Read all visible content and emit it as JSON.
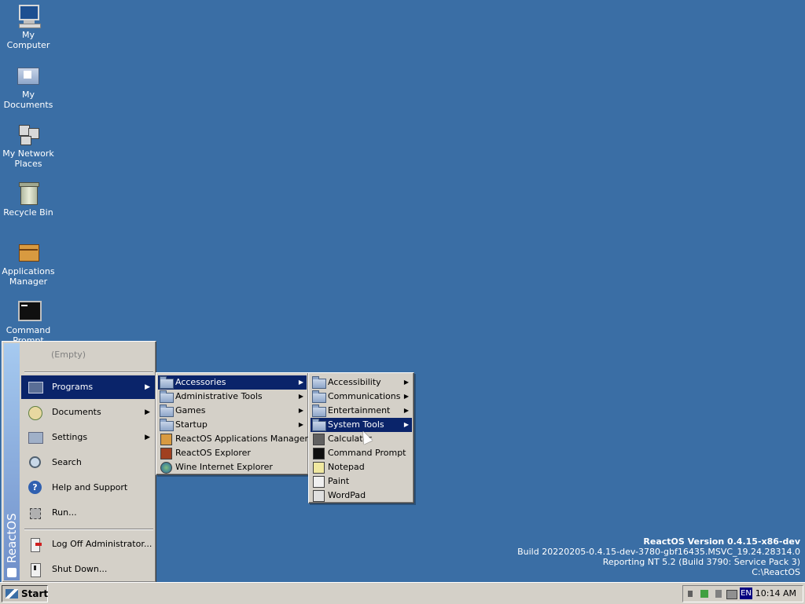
{
  "desktop": {
    "icons": [
      {
        "label": "My Computer",
        "icon": "my-computer-icon"
      },
      {
        "label": "My Documents",
        "icon": "my-documents-icon"
      },
      {
        "label": "My Network Places",
        "icon": "network-places-icon"
      },
      {
        "label": "Recycle Bin",
        "icon": "recycle-bin-icon"
      },
      {
        "label": "Applications Manager",
        "icon": "applications-manager-icon"
      },
      {
        "label": "Command Prompt",
        "icon": "command-prompt-icon"
      }
    ]
  },
  "start_menu": {
    "brand": "ReactOS",
    "recent_empty": "(Empty)",
    "items": [
      {
        "label": "Programs",
        "icon": "programs-icon",
        "has_submenu": true,
        "selected": true
      },
      {
        "label": "Documents",
        "icon": "documents-icon",
        "has_submenu": true
      },
      {
        "label": "Settings",
        "icon": "settings-icon",
        "has_submenu": true
      },
      {
        "label": "Search",
        "icon": "search-icon"
      },
      {
        "label": "Help and Support",
        "icon": "help-icon"
      },
      {
        "label": "Run...",
        "icon": "run-icon"
      },
      {
        "label": "Log Off Administrator...",
        "icon": "log-off-icon"
      },
      {
        "label": "Shut Down...",
        "icon": "shut-down-icon"
      }
    ]
  },
  "programs_menu": {
    "items": [
      {
        "label": "Accessories",
        "type": "folder",
        "has_submenu": true,
        "selected": true
      },
      {
        "label": "Administrative Tools",
        "type": "folder",
        "has_submenu": true
      },
      {
        "label": "Games",
        "type": "folder",
        "has_submenu": true
      },
      {
        "label": "Startup",
        "type": "folder",
        "has_submenu": true
      },
      {
        "label": "ReactOS Applications Manager",
        "type": "app"
      },
      {
        "label": "ReactOS Explorer",
        "type": "app"
      },
      {
        "label": "Wine Internet Explorer",
        "type": "app"
      }
    ]
  },
  "accessories_menu": {
    "items": [
      {
        "label": "Accessibility",
        "type": "folder",
        "has_submenu": true
      },
      {
        "label": "Communications",
        "type": "folder",
        "has_submenu": true
      },
      {
        "label": "Entertainment",
        "type": "folder",
        "has_submenu": true
      },
      {
        "label": "System Tools",
        "type": "folder",
        "has_submenu": true,
        "selected": true
      },
      {
        "label": "Calculator",
        "type": "app"
      },
      {
        "label": "Command Prompt",
        "type": "app"
      },
      {
        "label": "Notepad",
        "type": "app"
      },
      {
        "label": "Paint",
        "type": "app"
      },
      {
        "label": "WordPad",
        "type": "app"
      }
    ]
  },
  "version_info": {
    "line1": "ReactOS Version 0.4.15-x86-dev",
    "line2": "Build 20220205-0.4.15-dev-3780-gbf16435.MSVC_19.24.28314.0",
    "line3": "Reporting NT 5.2 (Build 3790: Service Pack 3)",
    "line4": "C:\\ReactOS"
  },
  "taskbar": {
    "start_label": "Start",
    "language": "EN",
    "clock": "10:14 AM"
  },
  "colors": {
    "desktop": "#3a6ea5",
    "menu_bg": "#d4d0c8",
    "selection": "#0a246a"
  }
}
